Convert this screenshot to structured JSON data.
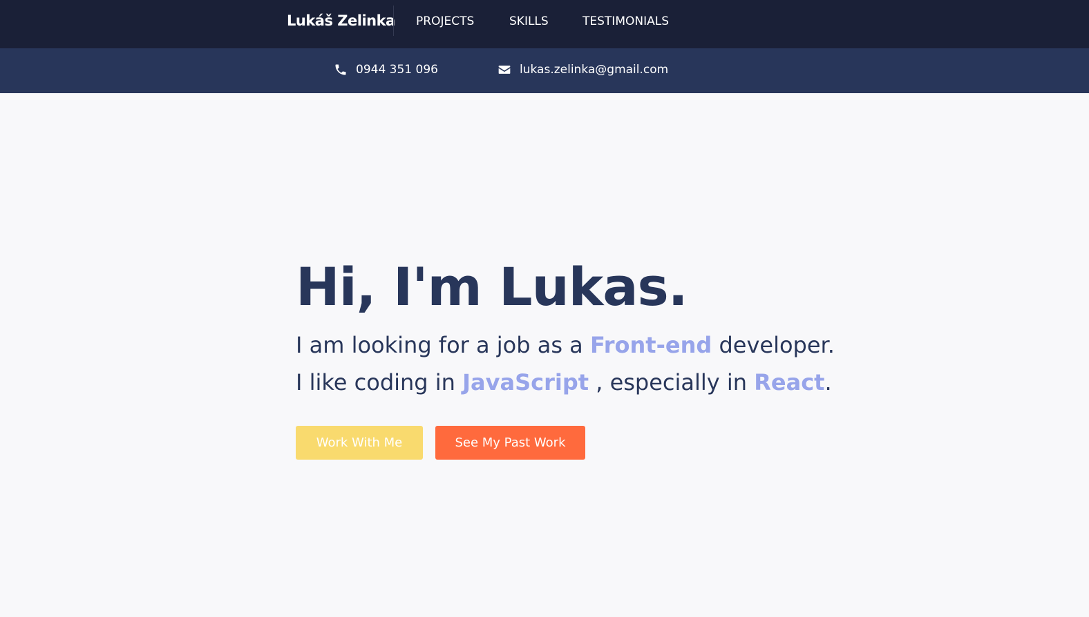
{
  "nav": {
    "brand": "Lukáš Zelinka",
    "links": [
      "PROJECTS",
      "SKILLS",
      "TESTIMONIALS"
    ]
  },
  "contact": {
    "phone": "0944 351 096",
    "phone_icon": "phone-icon",
    "email": "lukas.zelinka@gmail.com",
    "email_icon": "envelope-icon"
  },
  "hero": {
    "title": "Hi, I'm Lukas.",
    "line1": {
      "before": "I am looking for a job as a ",
      "highlight": "Front-end",
      "after": " developer."
    },
    "line2": {
      "before": "I like coding in ",
      "highlight1": "JavaScript",
      "middle": " , especially in ",
      "highlight2": "React",
      "after": "."
    },
    "buttons": {
      "primary": "Work With Me",
      "secondary": "See My Past Work"
    }
  },
  "colors": {
    "nav_bg": "#1a2037",
    "contact_bg": "#28365a",
    "page_bg": "#f8f8fa",
    "heading": "#28365a",
    "highlight": "#97a4ea",
    "button_yellow": "#f9da6e",
    "button_orange": "#ff6a3d"
  }
}
